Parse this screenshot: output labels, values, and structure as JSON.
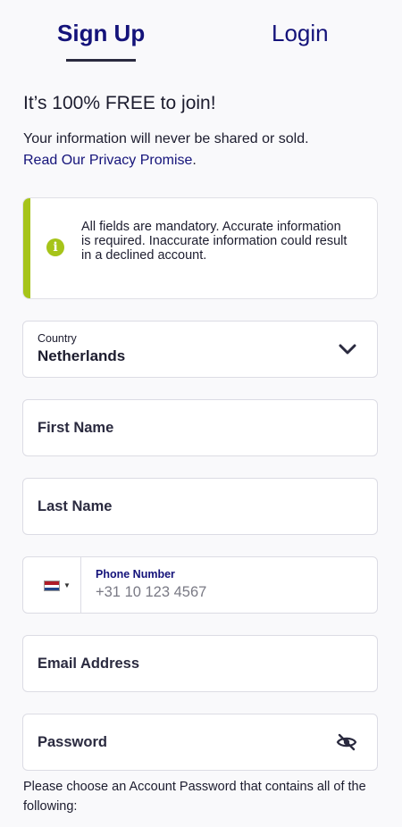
{
  "tabs": {
    "signup": "Sign Up",
    "login": "Login"
  },
  "heading": "It’s 100% FREE to join!",
  "subtext": "Your information will never be shared or sold.",
  "privacy_link": "Read Our Privacy Promise",
  "privacy_suffix": ".",
  "notice": {
    "icon": "info-icon",
    "text": "All fields are mandatory. Accurate information is required. Inaccurate information could result in a declined account.",
    "accent_color": "#a6c419"
  },
  "country": {
    "label": "Country",
    "value": "Netherlands"
  },
  "first_name": {
    "placeholder": "First Name"
  },
  "last_name": {
    "placeholder": "Last Name"
  },
  "phone": {
    "label": "Phone Number",
    "placeholder": "+31 10 123 4567",
    "flag": "netherlands-flag"
  },
  "email": {
    "placeholder": "Email Address"
  },
  "password": {
    "placeholder": "Password"
  },
  "password_hint": "Please choose an Account Password that contains all of the following:",
  "colors": {
    "primary": "#14137a",
    "text": "#1c1c2e",
    "background": "#f9f9fb"
  }
}
